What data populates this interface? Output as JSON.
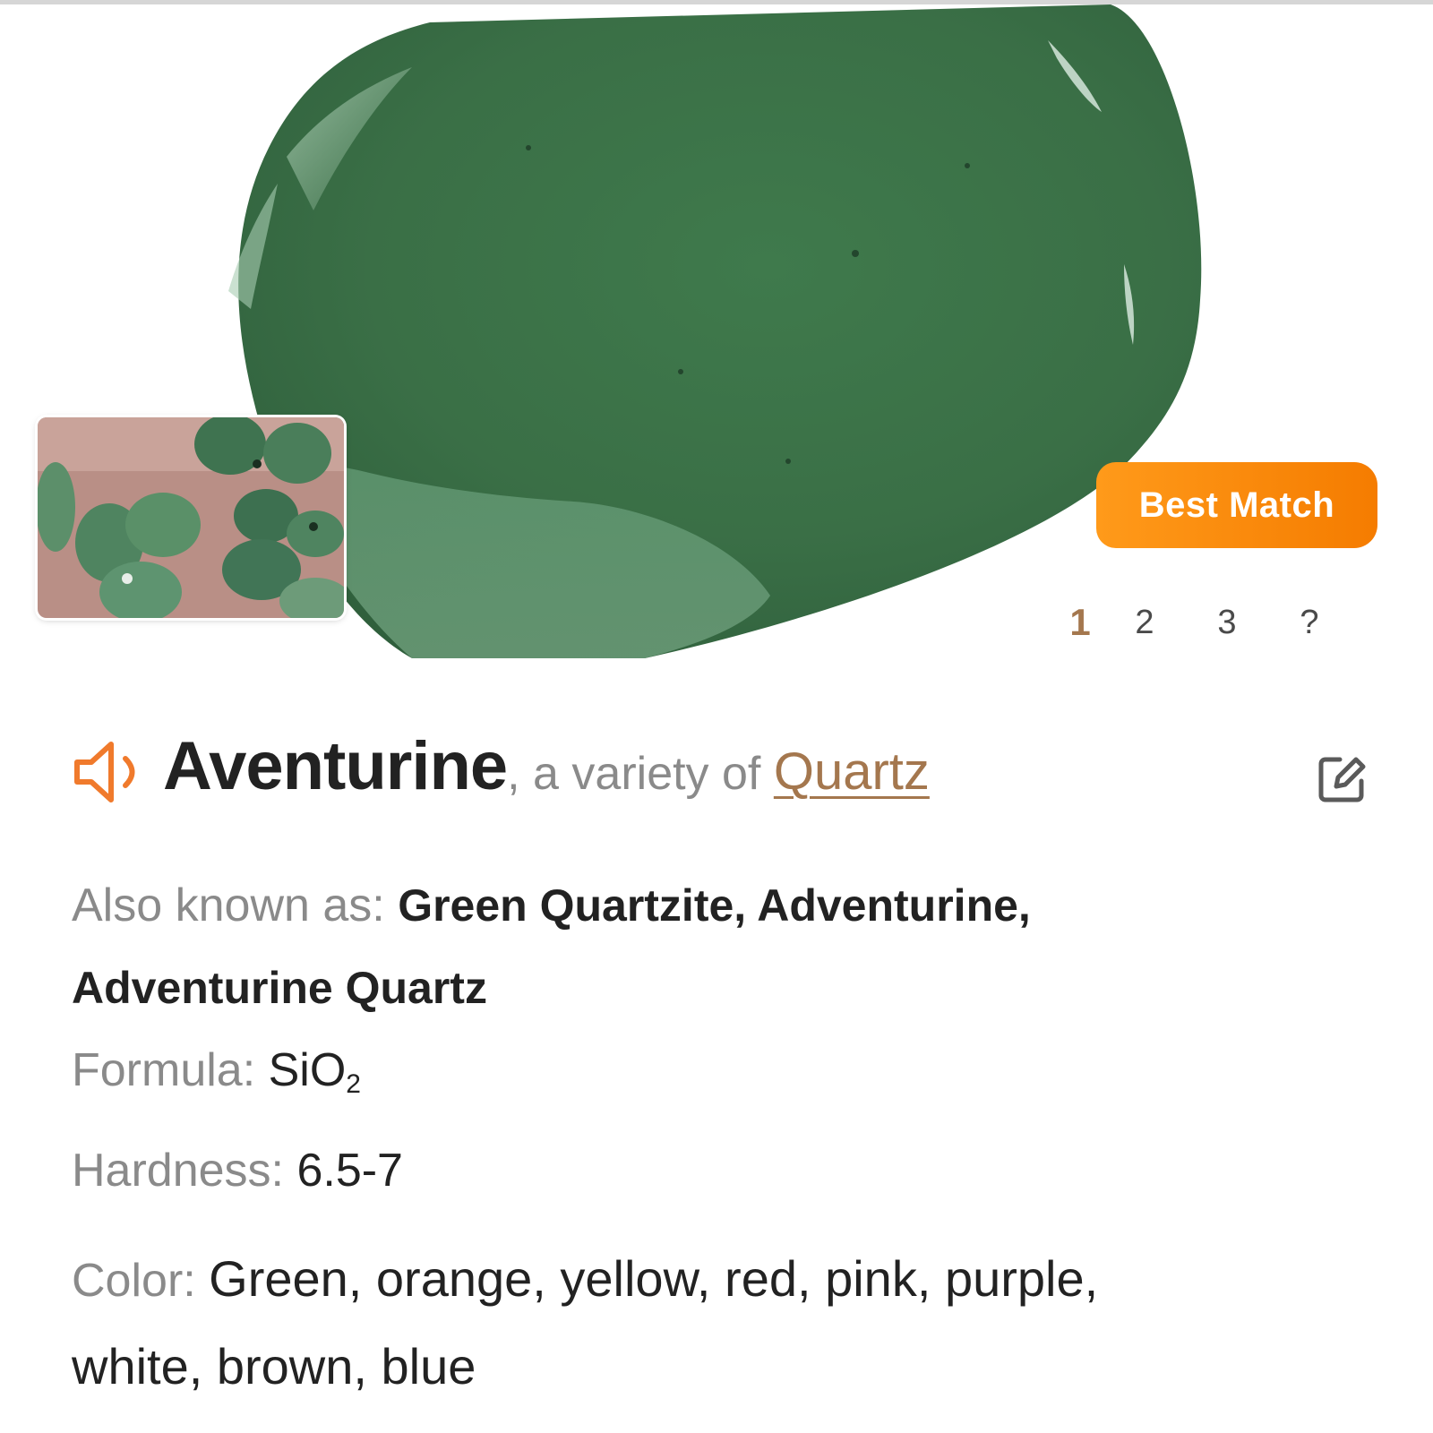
{
  "hero": {
    "badge_label": "Best Match",
    "pages": [
      "1",
      "2",
      "3",
      "?"
    ],
    "active_page": "1",
    "accent_color": "#f57c00"
  },
  "title": {
    "name": "Aventurine",
    "variety_prefix": ", a variety of ",
    "parent_link": "Quartz",
    "speaker_icon": "speaker-icon",
    "edit_icon": "edit-icon",
    "link_color": "#a4774e"
  },
  "details": {
    "aka_label": "Also known as: ",
    "aka_line1": "Green Quartzite, Adventurine,",
    "aka_line2": "Adventurine Quartz",
    "formula_label": "Formula: ",
    "formula_base": "SiO",
    "formula_subscript": "2",
    "hardness_label": "Hardness: ",
    "hardness_value": "6.5-7",
    "color_label": "Color: ",
    "color_line1": "Green, orange, yellow, red, pink, purple,",
    "color_line2": "white, brown, blue"
  }
}
